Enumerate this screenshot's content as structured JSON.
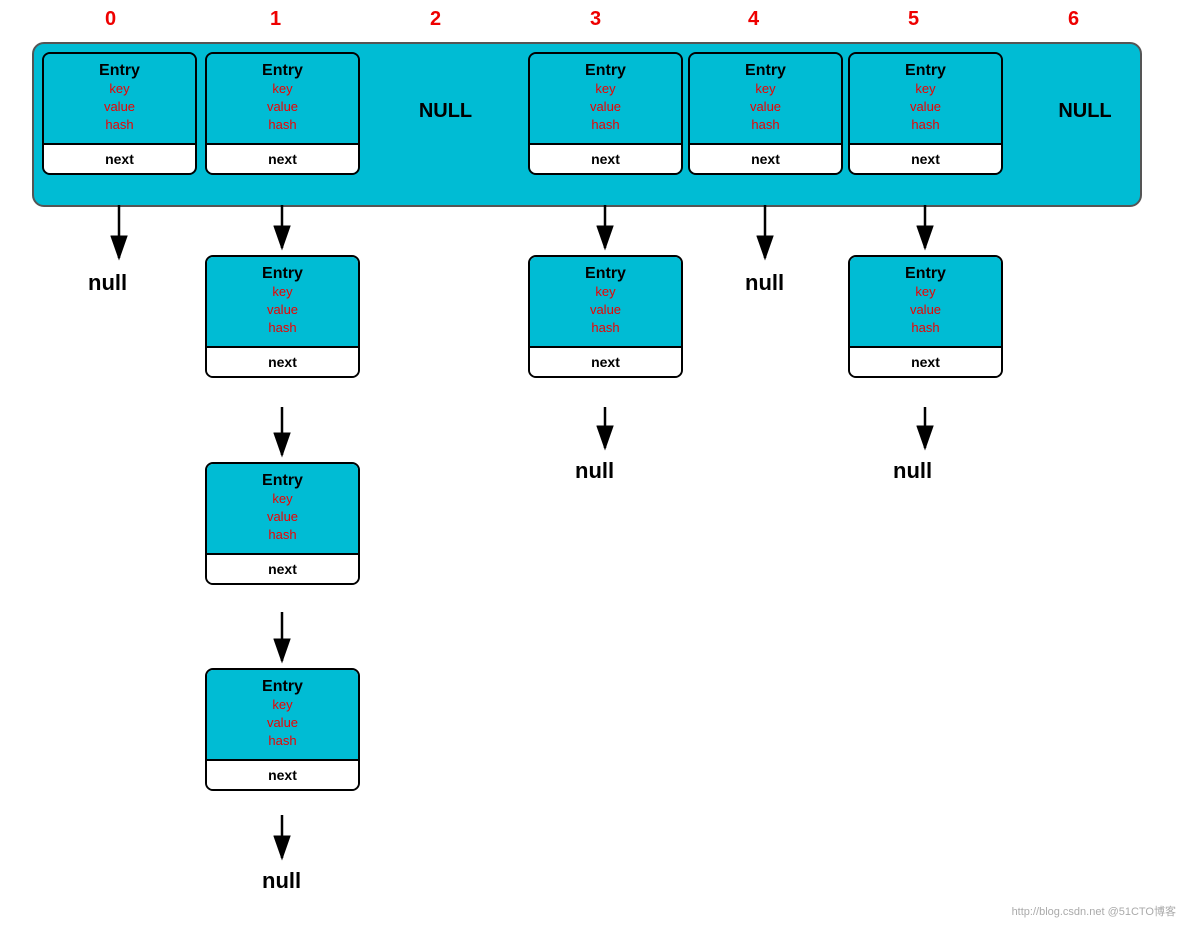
{
  "indices": [
    "0",
    "1",
    "2",
    "3",
    "4",
    "5",
    "6"
  ],
  "entry": {
    "title": "Entry",
    "fields": [
      "key",
      "value",
      "hash"
    ],
    "next": "next"
  },
  "null_text": "NULL",
  "null_label": "null",
  "watermark": "http://blog.csdn.net @51CTO博客"
}
